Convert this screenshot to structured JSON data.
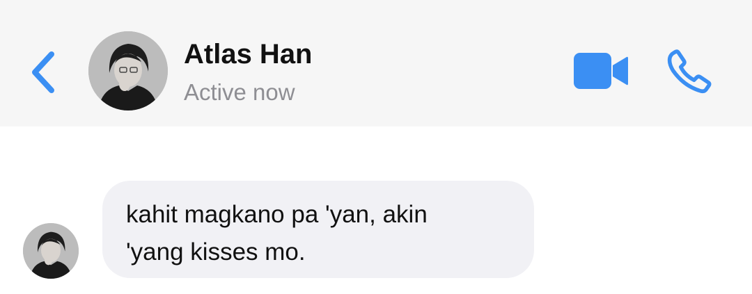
{
  "header": {
    "contact_name": "Atlas Han",
    "status": "Active now",
    "back_icon": "chevron-left-icon",
    "video_icon": "video-camera-icon",
    "call_icon": "phone-icon"
  },
  "messages": [
    {
      "sender": "Atlas Han",
      "lines": [
        "kahit magkano pa 'yan, akin",
        "'yang kisses mo."
      ]
    }
  ],
  "colors": {
    "accent": "#3b8ff3",
    "header_bg": "#f6f6f6",
    "bubble_bg": "#f1f1f5",
    "status_text": "#8e8e93"
  }
}
